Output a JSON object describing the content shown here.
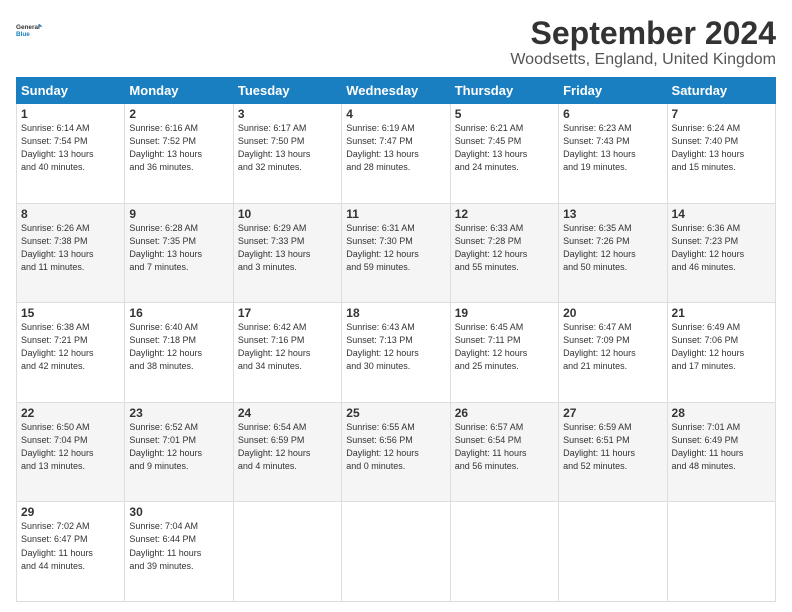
{
  "logo": {
    "line1": "General",
    "line2": "Blue"
  },
  "title": "September 2024",
  "subtitle": "Woodsetts, England, United Kingdom",
  "days_header": [
    "Sunday",
    "Monday",
    "Tuesday",
    "Wednesday",
    "Thursday",
    "Friday",
    "Saturday"
  ],
  "weeks": [
    [
      {
        "day": "1",
        "info": "Sunrise: 6:14 AM\nSunset: 7:54 PM\nDaylight: 13 hours\nand 40 minutes."
      },
      {
        "day": "2",
        "info": "Sunrise: 6:16 AM\nSunset: 7:52 PM\nDaylight: 13 hours\nand 36 minutes."
      },
      {
        "day": "3",
        "info": "Sunrise: 6:17 AM\nSunset: 7:50 PM\nDaylight: 13 hours\nand 32 minutes."
      },
      {
        "day": "4",
        "info": "Sunrise: 6:19 AM\nSunset: 7:47 PM\nDaylight: 13 hours\nand 28 minutes."
      },
      {
        "day": "5",
        "info": "Sunrise: 6:21 AM\nSunset: 7:45 PM\nDaylight: 13 hours\nand 24 minutes."
      },
      {
        "day": "6",
        "info": "Sunrise: 6:23 AM\nSunset: 7:43 PM\nDaylight: 13 hours\nand 19 minutes."
      },
      {
        "day": "7",
        "info": "Sunrise: 6:24 AM\nSunset: 7:40 PM\nDaylight: 13 hours\nand 15 minutes."
      }
    ],
    [
      {
        "day": "8",
        "info": "Sunrise: 6:26 AM\nSunset: 7:38 PM\nDaylight: 13 hours\nand 11 minutes."
      },
      {
        "day": "9",
        "info": "Sunrise: 6:28 AM\nSunset: 7:35 PM\nDaylight: 13 hours\nand 7 minutes."
      },
      {
        "day": "10",
        "info": "Sunrise: 6:29 AM\nSunset: 7:33 PM\nDaylight: 13 hours\nand 3 minutes."
      },
      {
        "day": "11",
        "info": "Sunrise: 6:31 AM\nSunset: 7:30 PM\nDaylight: 12 hours\nand 59 minutes."
      },
      {
        "day": "12",
        "info": "Sunrise: 6:33 AM\nSunset: 7:28 PM\nDaylight: 12 hours\nand 55 minutes."
      },
      {
        "day": "13",
        "info": "Sunrise: 6:35 AM\nSunset: 7:26 PM\nDaylight: 12 hours\nand 50 minutes."
      },
      {
        "day": "14",
        "info": "Sunrise: 6:36 AM\nSunset: 7:23 PM\nDaylight: 12 hours\nand 46 minutes."
      }
    ],
    [
      {
        "day": "15",
        "info": "Sunrise: 6:38 AM\nSunset: 7:21 PM\nDaylight: 12 hours\nand 42 minutes."
      },
      {
        "day": "16",
        "info": "Sunrise: 6:40 AM\nSunset: 7:18 PM\nDaylight: 12 hours\nand 38 minutes."
      },
      {
        "day": "17",
        "info": "Sunrise: 6:42 AM\nSunset: 7:16 PM\nDaylight: 12 hours\nand 34 minutes."
      },
      {
        "day": "18",
        "info": "Sunrise: 6:43 AM\nSunset: 7:13 PM\nDaylight: 12 hours\nand 30 minutes."
      },
      {
        "day": "19",
        "info": "Sunrise: 6:45 AM\nSunset: 7:11 PM\nDaylight: 12 hours\nand 25 minutes."
      },
      {
        "day": "20",
        "info": "Sunrise: 6:47 AM\nSunset: 7:09 PM\nDaylight: 12 hours\nand 21 minutes."
      },
      {
        "day": "21",
        "info": "Sunrise: 6:49 AM\nSunset: 7:06 PM\nDaylight: 12 hours\nand 17 minutes."
      }
    ],
    [
      {
        "day": "22",
        "info": "Sunrise: 6:50 AM\nSunset: 7:04 PM\nDaylight: 12 hours\nand 13 minutes."
      },
      {
        "day": "23",
        "info": "Sunrise: 6:52 AM\nSunset: 7:01 PM\nDaylight: 12 hours\nand 9 minutes."
      },
      {
        "day": "24",
        "info": "Sunrise: 6:54 AM\nSunset: 6:59 PM\nDaylight: 12 hours\nand 4 minutes."
      },
      {
        "day": "25",
        "info": "Sunrise: 6:55 AM\nSunset: 6:56 PM\nDaylight: 12 hours\nand 0 minutes."
      },
      {
        "day": "26",
        "info": "Sunrise: 6:57 AM\nSunset: 6:54 PM\nDaylight: 11 hours\nand 56 minutes."
      },
      {
        "day": "27",
        "info": "Sunrise: 6:59 AM\nSunset: 6:51 PM\nDaylight: 11 hours\nand 52 minutes."
      },
      {
        "day": "28",
        "info": "Sunrise: 7:01 AM\nSunset: 6:49 PM\nDaylight: 11 hours\nand 48 minutes."
      }
    ],
    [
      {
        "day": "29",
        "info": "Sunrise: 7:02 AM\nSunset: 6:47 PM\nDaylight: 11 hours\nand 44 minutes."
      },
      {
        "day": "30",
        "info": "Sunrise: 7:04 AM\nSunset: 6:44 PM\nDaylight: 11 hours\nand 39 minutes."
      },
      {
        "day": "",
        "info": ""
      },
      {
        "day": "",
        "info": ""
      },
      {
        "day": "",
        "info": ""
      },
      {
        "day": "",
        "info": ""
      },
      {
        "day": "",
        "info": ""
      }
    ]
  ]
}
